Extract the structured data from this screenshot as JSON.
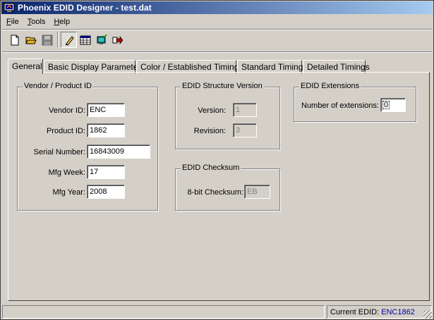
{
  "window": {
    "title": "Phoenix EDID Designer - test.dat"
  },
  "menu": {
    "file": "File",
    "tools": "Tools",
    "help": "Help"
  },
  "toolbar": {
    "buttons": [
      "new-file-icon",
      "open-folder-icon",
      "save-disk-icon",
      "edit-pencil-icon",
      "grid-table-icon",
      "monitor-check-icon",
      "export-arrow-icon"
    ]
  },
  "tabs": [
    {
      "label": "General",
      "active": true
    },
    {
      "label": "Basic Display Parameters"
    },
    {
      "label": "Color /  Established Timings"
    },
    {
      "label": "Standard Timings"
    },
    {
      "label": "Detailed Timings"
    }
  ],
  "vendor_group": {
    "title": "Vendor / Product ID",
    "vendor_id_label": "Vendor ID:",
    "vendor_id": "ENC",
    "product_id_label": "Product ID:",
    "product_id": "1862",
    "serial_label": "Serial Number:",
    "serial": "16843009",
    "mfg_week_label": "Mfg Week:",
    "mfg_week": "17",
    "mfg_year_label": "Mfg Year:",
    "mfg_year": "2008"
  },
  "structure_group": {
    "title": "EDID Structure Version",
    "version_label": "Version:",
    "version": "1",
    "revision_label": "Revision:",
    "revision": "3"
  },
  "checksum_group": {
    "title": "EDID Checksum",
    "checksum_label": "8-bit Checksum:",
    "checksum": "EB"
  },
  "extensions_group": {
    "title": "EDID Extensions",
    "count_label": "Number of extensions:",
    "count": "0"
  },
  "status": {
    "current_label": "Current EDID:",
    "current_value": "ENC1862"
  },
  "colors": {
    "title_start": "#0a246a",
    "title_end": "#a6caf0",
    "face": "#d4d0c8",
    "status_value": "#0000a0"
  }
}
